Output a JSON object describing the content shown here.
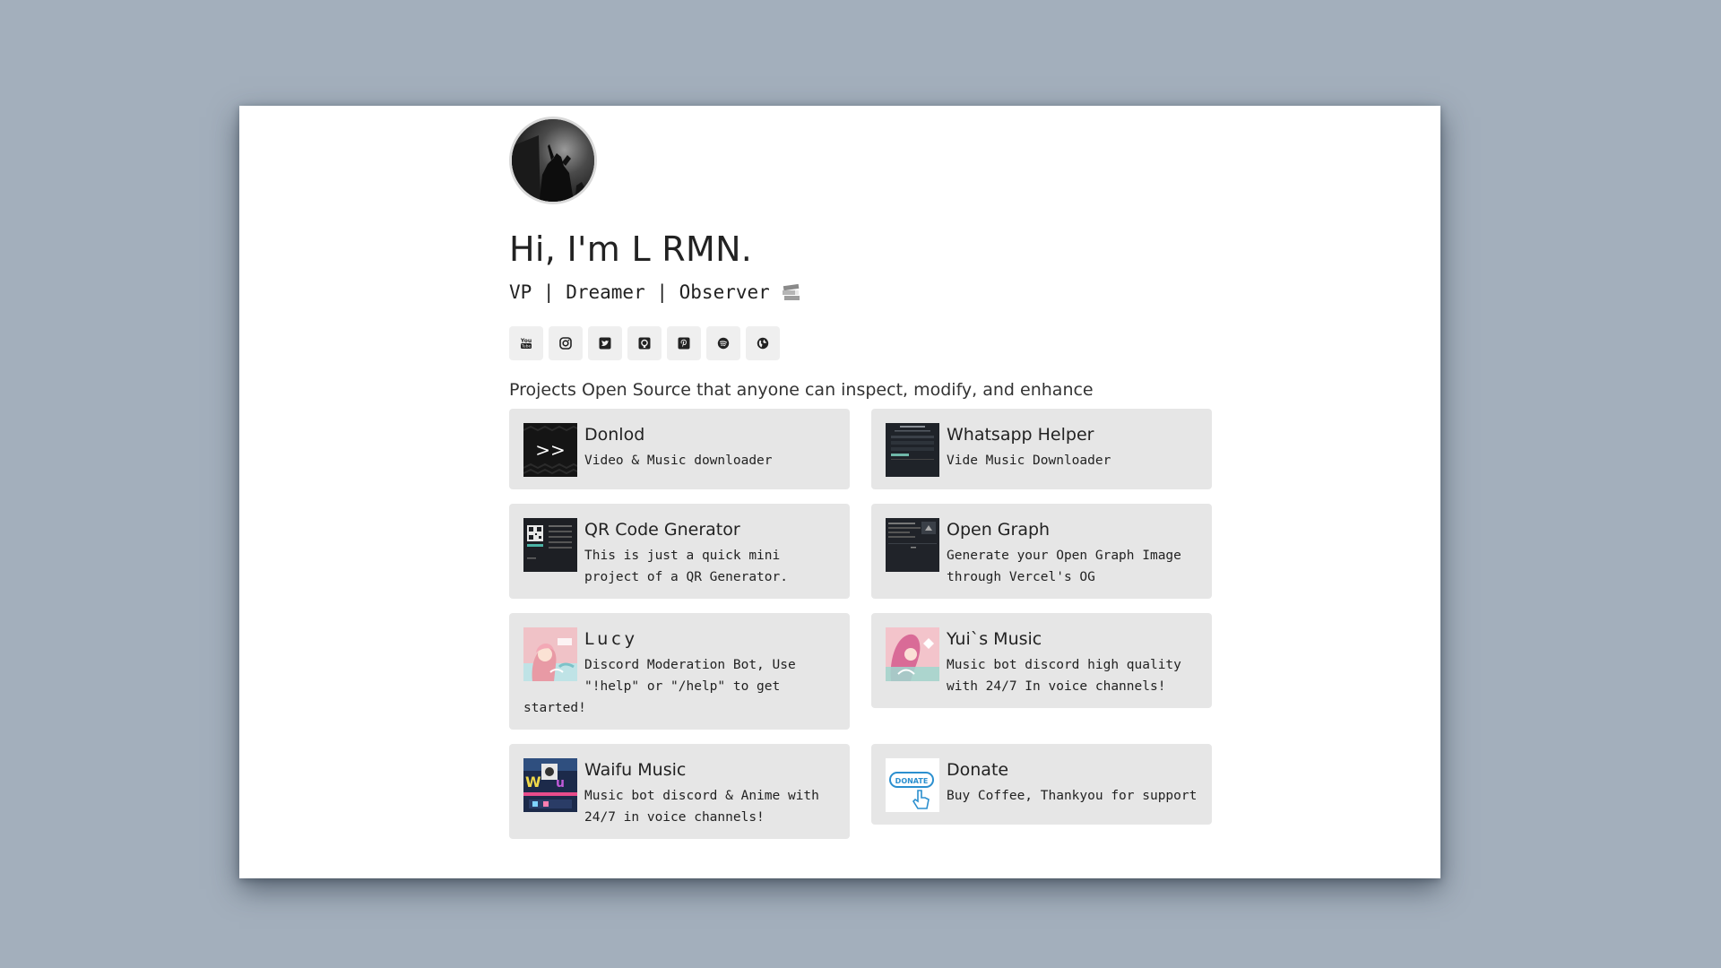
{
  "profile": {
    "heading": "Hi, I'm L RMN.",
    "tagline": "VP | Dreamer | Observer",
    "intro": "Projects Open Source that anyone can inspect, modify, and enhance"
  },
  "socials": [
    {
      "icon": "youtube-icon"
    },
    {
      "icon": "instagram-icon"
    },
    {
      "icon": "twitter-icon"
    },
    {
      "icon": "github-icon"
    },
    {
      "icon": "pinterest-icon"
    },
    {
      "icon": "spotify-icon"
    },
    {
      "icon": "globe-icon"
    }
  ],
  "projects": [
    {
      "name": "Donlod",
      "description": "Video & Music downloader"
    },
    {
      "name": "Whatsapp Helper",
      "description": "Vide Music Downloader"
    },
    {
      "name": "QR Code Gnerator",
      "description": "This is just a quick mini project of a QR Generator."
    },
    {
      "name": "Open Graph",
      "description": "Generate your Open Graph Image through Vercel's OG"
    },
    {
      "name": "Lucy",
      "description": "Discord Moderation Bot, Use \"!help\" or \"/help\" to get started!"
    },
    {
      "name": "Yui`s Music",
      "description": "Music bot discord high quality with 24/7 In voice channels!"
    },
    {
      "name": "Waifu Music",
      "description": "Music bot discord & Anime with 24/7 in voice channels!"
    },
    {
      "name": "Donate",
      "description": "Buy Coffee, Thankyou for support"
    }
  ],
  "thumbnails": {
    "donate_text": "DONATE",
    "donlod_text": ">>"
  },
  "colors": {
    "background": "#a3afbc",
    "card": "#e6e6e6",
    "text": "#222222"
  }
}
